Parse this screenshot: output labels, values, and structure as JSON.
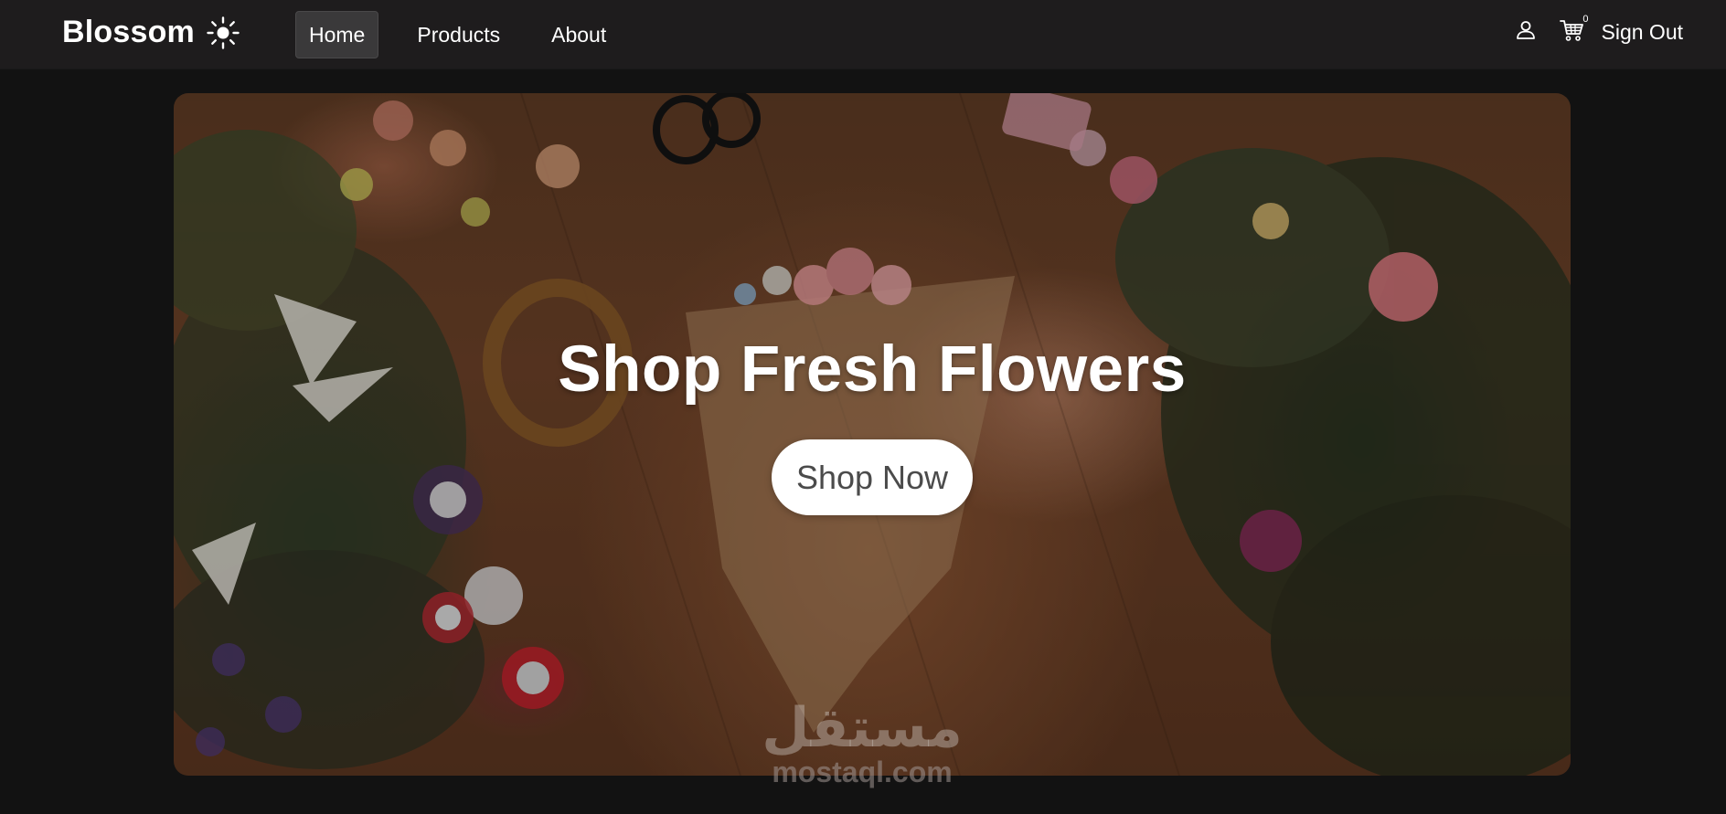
{
  "navbar": {
    "brand": "Blossom",
    "links": [
      {
        "label": "Home",
        "active": true
      },
      {
        "label": "Products",
        "active": false
      },
      {
        "label": "About",
        "active": false
      }
    ],
    "cart_count": "0",
    "signout_label": "Sign Out"
  },
  "hero": {
    "title": "Shop Fresh Flowers",
    "cta_label": "Shop Now"
  },
  "watermark": {
    "arabic": "مستقل",
    "latin": "mostaql.com"
  },
  "colors": {
    "page_bg": "#121212",
    "navbar_bg": "#1e1c1d",
    "active_link_bg": "#3a393a",
    "text": "#ffffff",
    "cta_bg": "#ffffff",
    "cta_text": "#4b4b4b"
  },
  "icons": {
    "brand": "sun-icon",
    "account": "user-icon",
    "cart": "cart-icon"
  }
}
